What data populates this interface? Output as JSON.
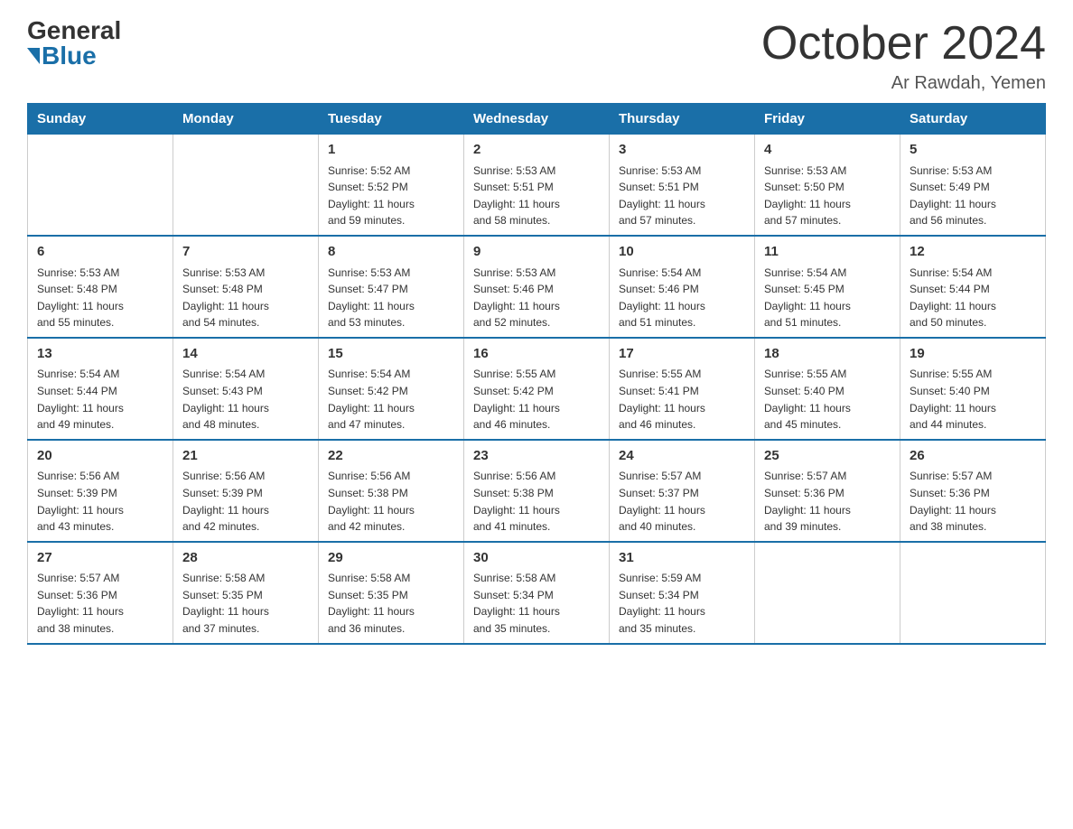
{
  "header": {
    "logo_general": "General",
    "logo_blue": "Blue",
    "month_title": "October 2024",
    "location": "Ar Rawdah, Yemen"
  },
  "weekdays": [
    "Sunday",
    "Monday",
    "Tuesday",
    "Wednesday",
    "Thursday",
    "Friday",
    "Saturday"
  ],
  "weeks": [
    [
      {
        "day": "",
        "info": ""
      },
      {
        "day": "",
        "info": ""
      },
      {
        "day": "1",
        "info": "Sunrise: 5:52 AM\nSunset: 5:52 PM\nDaylight: 11 hours\nand 59 minutes."
      },
      {
        "day": "2",
        "info": "Sunrise: 5:53 AM\nSunset: 5:51 PM\nDaylight: 11 hours\nand 58 minutes."
      },
      {
        "day": "3",
        "info": "Sunrise: 5:53 AM\nSunset: 5:51 PM\nDaylight: 11 hours\nand 57 minutes."
      },
      {
        "day": "4",
        "info": "Sunrise: 5:53 AM\nSunset: 5:50 PM\nDaylight: 11 hours\nand 57 minutes."
      },
      {
        "day": "5",
        "info": "Sunrise: 5:53 AM\nSunset: 5:49 PM\nDaylight: 11 hours\nand 56 minutes."
      }
    ],
    [
      {
        "day": "6",
        "info": "Sunrise: 5:53 AM\nSunset: 5:48 PM\nDaylight: 11 hours\nand 55 minutes."
      },
      {
        "day": "7",
        "info": "Sunrise: 5:53 AM\nSunset: 5:48 PM\nDaylight: 11 hours\nand 54 minutes."
      },
      {
        "day": "8",
        "info": "Sunrise: 5:53 AM\nSunset: 5:47 PM\nDaylight: 11 hours\nand 53 minutes."
      },
      {
        "day": "9",
        "info": "Sunrise: 5:53 AM\nSunset: 5:46 PM\nDaylight: 11 hours\nand 52 minutes."
      },
      {
        "day": "10",
        "info": "Sunrise: 5:54 AM\nSunset: 5:46 PM\nDaylight: 11 hours\nand 51 minutes."
      },
      {
        "day": "11",
        "info": "Sunrise: 5:54 AM\nSunset: 5:45 PM\nDaylight: 11 hours\nand 51 minutes."
      },
      {
        "day": "12",
        "info": "Sunrise: 5:54 AM\nSunset: 5:44 PM\nDaylight: 11 hours\nand 50 minutes."
      }
    ],
    [
      {
        "day": "13",
        "info": "Sunrise: 5:54 AM\nSunset: 5:44 PM\nDaylight: 11 hours\nand 49 minutes."
      },
      {
        "day": "14",
        "info": "Sunrise: 5:54 AM\nSunset: 5:43 PM\nDaylight: 11 hours\nand 48 minutes."
      },
      {
        "day": "15",
        "info": "Sunrise: 5:54 AM\nSunset: 5:42 PM\nDaylight: 11 hours\nand 47 minutes."
      },
      {
        "day": "16",
        "info": "Sunrise: 5:55 AM\nSunset: 5:42 PM\nDaylight: 11 hours\nand 46 minutes."
      },
      {
        "day": "17",
        "info": "Sunrise: 5:55 AM\nSunset: 5:41 PM\nDaylight: 11 hours\nand 46 minutes."
      },
      {
        "day": "18",
        "info": "Sunrise: 5:55 AM\nSunset: 5:40 PM\nDaylight: 11 hours\nand 45 minutes."
      },
      {
        "day": "19",
        "info": "Sunrise: 5:55 AM\nSunset: 5:40 PM\nDaylight: 11 hours\nand 44 minutes."
      }
    ],
    [
      {
        "day": "20",
        "info": "Sunrise: 5:56 AM\nSunset: 5:39 PM\nDaylight: 11 hours\nand 43 minutes."
      },
      {
        "day": "21",
        "info": "Sunrise: 5:56 AM\nSunset: 5:39 PM\nDaylight: 11 hours\nand 42 minutes."
      },
      {
        "day": "22",
        "info": "Sunrise: 5:56 AM\nSunset: 5:38 PM\nDaylight: 11 hours\nand 42 minutes."
      },
      {
        "day": "23",
        "info": "Sunrise: 5:56 AM\nSunset: 5:38 PM\nDaylight: 11 hours\nand 41 minutes."
      },
      {
        "day": "24",
        "info": "Sunrise: 5:57 AM\nSunset: 5:37 PM\nDaylight: 11 hours\nand 40 minutes."
      },
      {
        "day": "25",
        "info": "Sunrise: 5:57 AM\nSunset: 5:36 PM\nDaylight: 11 hours\nand 39 minutes."
      },
      {
        "day": "26",
        "info": "Sunrise: 5:57 AM\nSunset: 5:36 PM\nDaylight: 11 hours\nand 38 minutes."
      }
    ],
    [
      {
        "day": "27",
        "info": "Sunrise: 5:57 AM\nSunset: 5:36 PM\nDaylight: 11 hours\nand 38 minutes."
      },
      {
        "day": "28",
        "info": "Sunrise: 5:58 AM\nSunset: 5:35 PM\nDaylight: 11 hours\nand 37 minutes."
      },
      {
        "day": "29",
        "info": "Sunrise: 5:58 AM\nSunset: 5:35 PM\nDaylight: 11 hours\nand 36 minutes."
      },
      {
        "day": "30",
        "info": "Sunrise: 5:58 AM\nSunset: 5:34 PM\nDaylight: 11 hours\nand 35 minutes."
      },
      {
        "day": "31",
        "info": "Sunrise: 5:59 AM\nSunset: 5:34 PM\nDaylight: 11 hours\nand 35 minutes."
      },
      {
        "day": "",
        "info": ""
      },
      {
        "day": "",
        "info": ""
      }
    ]
  ]
}
